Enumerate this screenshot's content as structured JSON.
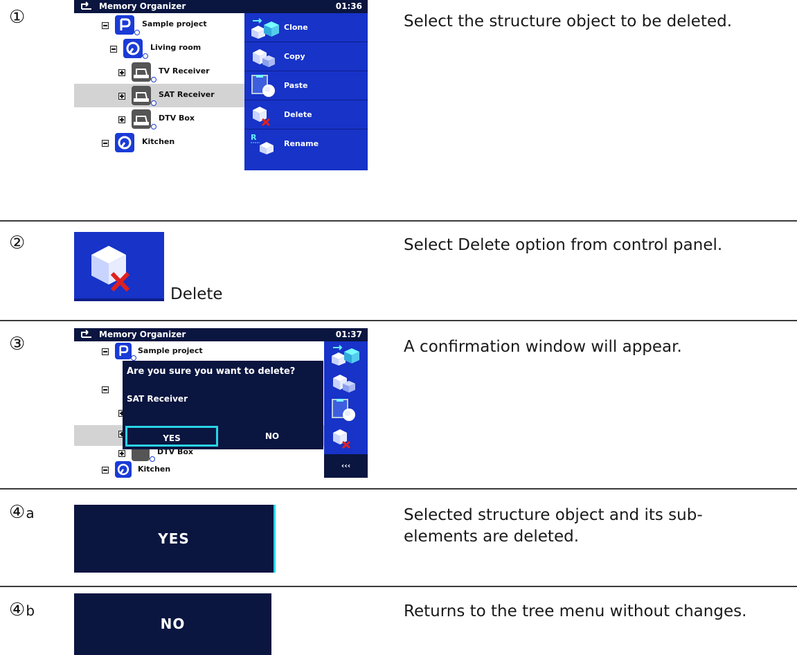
{
  "steps": {
    "s1": {
      "marker": "①",
      "desc": "Select the structure object to be deleted."
    },
    "s2": {
      "marker": "②",
      "desc": "Select Delete option from control panel."
    },
    "s3": {
      "marker": "③",
      "desc": "A confirmation window will appear."
    },
    "s4a": {
      "marker": "④",
      "sub": "a",
      "desc_line1": "Selected structure object and its sub-",
      "desc_line2": "elements are deleted."
    },
    "s4b": {
      "marker": "④",
      "sub": "b",
      "desc": "Returns to the tree menu without changes."
    }
  },
  "screen1": {
    "title": "Memory Organizer",
    "time": "01:36",
    "tree": {
      "project": "Sample project",
      "room": "Living room",
      "dev1": "TV Receiver",
      "dev2": "SAT Receiver",
      "dev3": "DTV Box",
      "room2": "Kitchen"
    },
    "panel": {
      "clone": "Clone",
      "copy": "Copy",
      "paste": "Paste",
      "delete": "Delete",
      "rename": "Rename"
    }
  },
  "delete_button": {
    "label": "Delete"
  },
  "screen3": {
    "title": "Memory Organizer",
    "time": "01:37",
    "tree": {
      "project": "Sample project",
      "dev3": "DTV Box",
      "room2": "Kitchen"
    },
    "dialog": {
      "question": "Are you sure you want to delete?",
      "item": "SAT Receiver",
      "yes": "YES",
      "no": "NO"
    },
    "more": "‹‹‹"
  },
  "yes_button": {
    "label": "YES"
  },
  "no_button": {
    "label": "NO"
  },
  "colors": {
    "accent": "#1733c8",
    "dark": "#0a1540",
    "highlight": "#2ad3e6",
    "delete_x": "#e02020"
  }
}
